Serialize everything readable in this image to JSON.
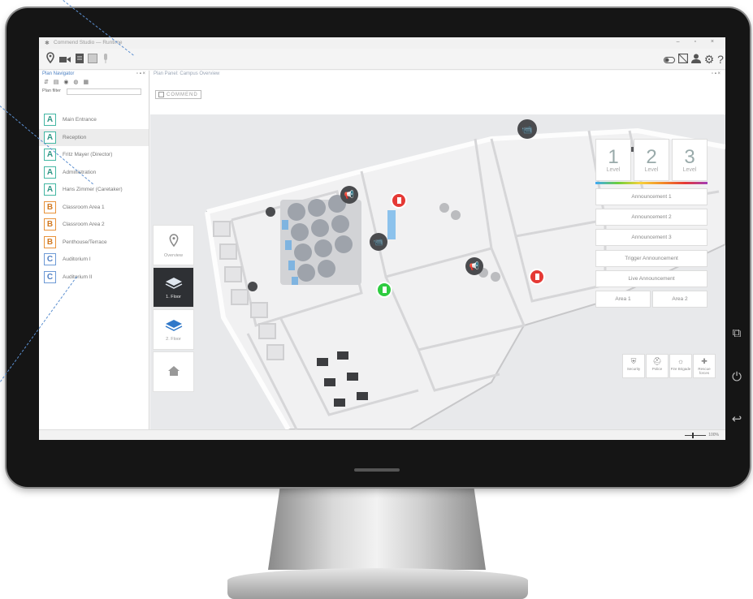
{
  "window": {
    "title": "Commend Studio — Runtime",
    "controls": "– ▫ ×"
  },
  "toolbar": {
    "left_icons": [
      "location-pin-icon",
      "video-camera-icon",
      "document-icon",
      "screen-icon",
      "microphone-icon"
    ],
    "right_icons": [
      "toggle-icon",
      "layout-icon",
      "user-icon",
      "gear-icon",
      "help-icon"
    ]
  },
  "navigator": {
    "title": "Plan Navigator",
    "controls": "▫ ▪ ×",
    "filter_label": "Plan filter",
    "filter_value": "",
    "items": [
      {
        "badge": "A",
        "label": "Main Entrance"
      },
      {
        "badge": "A",
        "label": "Reception"
      },
      {
        "badge": "A",
        "label": "Fritz Mayer (Director)"
      },
      {
        "badge": "A",
        "label": "Administration"
      },
      {
        "badge": "A",
        "label": "Hans Zimmer (Caretaker)"
      },
      {
        "badge": "B",
        "label": "Classroom Area 1"
      },
      {
        "badge": "B",
        "label": "Classroom Area 2"
      },
      {
        "badge": "B",
        "label": "Penthouse/Terrace"
      },
      {
        "badge": "C",
        "label": "Auditorium I"
      },
      {
        "badge": "C",
        "label": "Auditorium II"
      }
    ],
    "selected_index": 1
  },
  "plan": {
    "title": "Plan Panel: Campus Overview",
    "controls": "▫ ▪ ×",
    "brand": "COMMEND",
    "floors": [
      {
        "label": "Overview",
        "icon": "location-pin-icon"
      },
      {
        "label": "1. Floor",
        "icon": "layers-icon",
        "active": true
      },
      {
        "label": "2. Floor",
        "icon": "layers-icon"
      },
      {
        "label": "",
        "icon": "home-icon"
      }
    ],
    "levels": [
      {
        "number": "1",
        "label": "Level"
      },
      {
        "number": "2",
        "label": "Level"
      },
      {
        "number": "3",
        "label": "Level"
      }
    ],
    "announcements": [
      "Announcement 1",
      "Announcement 2",
      "Announcement 3",
      "Trigger Announcement",
      "Live Announcement"
    ],
    "areas": [
      "Area 1",
      "Area 2"
    ],
    "emergency": [
      {
        "label": "Security",
        "icon": "shield-icon"
      },
      {
        "label": "Police",
        "icon": "police-cap-icon"
      },
      {
        "label": "Fire Brigade",
        "icon": "fire-icon"
      },
      {
        "label": "Rescue forces",
        "icon": "cross-icon"
      }
    ]
  },
  "status": {
    "zoom": "100%"
  },
  "colors": {
    "accent_blue": "#4a7fc1",
    "badge_A": "#43b7a3",
    "badge_B": "#e8923a",
    "badge_C": "#6d9ad6",
    "door_open": "#2ecc40",
    "door_alarm": "#e53935",
    "floor_active": "#2e3034"
  }
}
